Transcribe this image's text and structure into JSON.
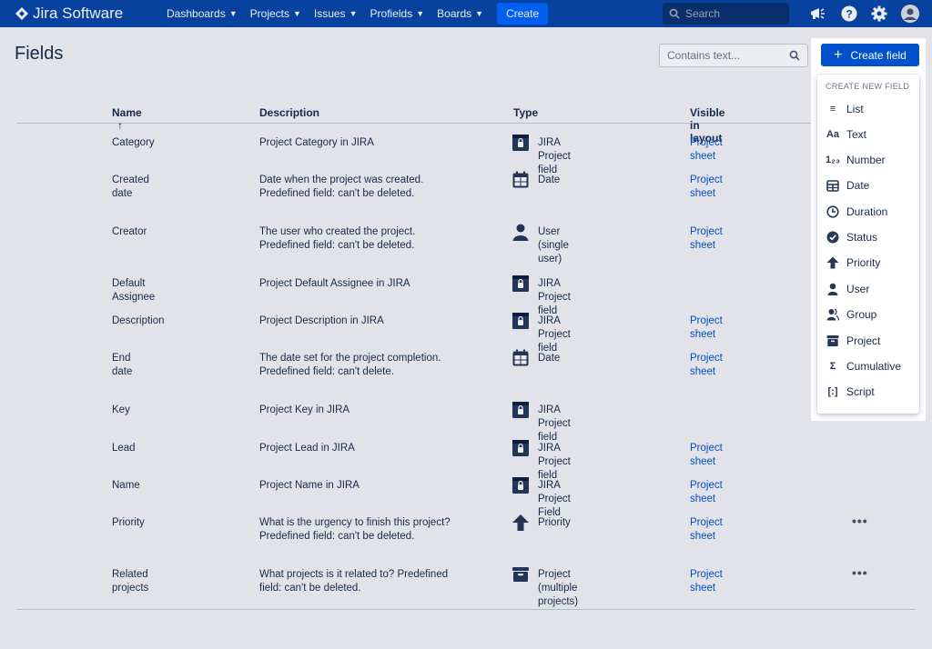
{
  "nav": {
    "brand": "Jira Software",
    "items": [
      {
        "label": "Dashboards"
      },
      {
        "label": "Projects"
      },
      {
        "label": "Issues"
      },
      {
        "label": "Profields"
      },
      {
        "label": "Boards"
      }
    ],
    "create_label": "Create",
    "search_placeholder": "Search"
  },
  "page": {
    "title": "Fields",
    "filter_placeholder": "Contains text...",
    "create_field_label": "Create field"
  },
  "table": {
    "headers": {
      "name": "Name",
      "sort": "↑",
      "description": "Description",
      "type": "Type",
      "visible": "Visible in layout"
    },
    "rows": [
      {
        "name": "Category",
        "desc1": "Project Category in JIRA",
        "desc2": "",
        "type": "JIRA Project field",
        "type_icon": "project-field-icon",
        "visible": "Project sheet",
        "more": ""
      },
      {
        "name": "Created date",
        "desc1": "Date when the project was created.",
        "desc2": "Predefined field: can't be deleted.",
        "type": "Date",
        "type_icon": "date-icon",
        "visible": "Project sheet",
        "more": ""
      },
      {
        "name": "Creator",
        "desc1": "The user who created the project.",
        "desc2": "Predefined field: can't be deleted.",
        "type": "User (single user)",
        "type_icon": "user-icon",
        "visible": "Project sheet",
        "more": ""
      },
      {
        "name": "Default Assignee",
        "desc1": "Project Default Assignee in JIRA",
        "desc2": "",
        "type": "JIRA Project field",
        "type_icon": "project-field-icon",
        "visible": "",
        "more": ""
      },
      {
        "name": "Description",
        "desc1": "Project Description in JIRA",
        "desc2": "",
        "type": "JIRA Project field",
        "type_icon": "project-field-icon",
        "visible": "Project sheet",
        "more": ""
      },
      {
        "name": "End date",
        "desc1": "The date set for the project completion.",
        "desc2": "Predefined field: can't delete.",
        "type": "Date",
        "type_icon": "date-icon",
        "visible": "Project sheet",
        "more": ""
      },
      {
        "name": "Key",
        "desc1": "Project Key in JIRA",
        "desc2": "",
        "type": "JIRA Project field",
        "type_icon": "project-field-icon",
        "visible": "",
        "more": ""
      },
      {
        "name": "Lead",
        "desc1": "Project Lead in JIRA",
        "desc2": "",
        "type": "JIRA Project field",
        "type_icon": "project-field-icon",
        "visible": "Project sheet",
        "more": ""
      },
      {
        "name": "Name",
        "desc1": "Project Name in JIRA",
        "desc2": "",
        "type": "JIRA Project Field",
        "type_icon": "project-field-icon",
        "visible": "Project sheet",
        "more": ""
      },
      {
        "name": "Priority",
        "desc1": "What is the urgency to finish this project?",
        "desc2": "Predefined field: can't be deleted.",
        "type": "Priority",
        "type_icon": "priority-arrow-icon",
        "visible": "Project sheet",
        "more": "•••"
      },
      {
        "name": "Related projects",
        "desc1": "What projects is it related to? Predefined",
        "desc2": "field: can't be deleted.",
        "type": "Project (multiple projects)",
        "type_icon": "project-icon",
        "visible": "Project sheet",
        "more": "•••"
      }
    ]
  },
  "dropdown": {
    "heading": "CREATE NEW FIELD",
    "items": [
      {
        "label": "List",
        "icon": "list-icon",
        "glyph": "≡"
      },
      {
        "label": "Text",
        "icon": "text-icon",
        "glyph": "Aa"
      },
      {
        "label": "Number",
        "icon": "number-icon",
        "glyph": "1₂₃"
      },
      {
        "label": "Date",
        "icon": "date-icon",
        "glyph": ""
      },
      {
        "label": "Duration",
        "icon": "clock-icon",
        "glyph": ""
      },
      {
        "label": "Status",
        "icon": "check-circle-icon",
        "glyph": ""
      },
      {
        "label": "Priority",
        "icon": "priority-arrow-icon",
        "glyph": ""
      },
      {
        "label": "User",
        "icon": "user-icon",
        "glyph": ""
      },
      {
        "label": "Group",
        "icon": "group-icon",
        "glyph": ""
      },
      {
        "label": "Project",
        "icon": "project-icon",
        "glyph": ""
      },
      {
        "label": "Cumulative",
        "icon": "sigma-icon",
        "glyph": "Σ"
      },
      {
        "label": "Script",
        "icon": "script-icon",
        "glyph": "[:]"
      }
    ]
  },
  "colors": {
    "nav_bg": "#0747A6",
    "primary": "#0052CC",
    "text": "#172B4D",
    "link": "#0052CC"
  }
}
